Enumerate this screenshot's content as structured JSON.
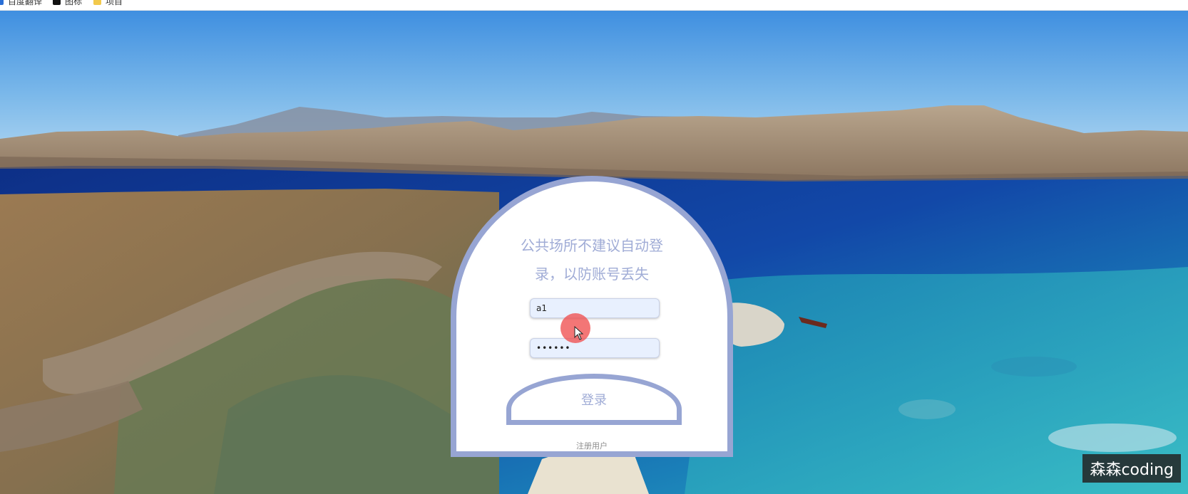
{
  "bookmarks": [
    {
      "label": "百度翻译",
      "icon": "translate-icon",
      "color": "#2a6fd6"
    },
    {
      "label": "图标",
      "icon": "iconfont-icon",
      "color": "#111111"
    },
    {
      "label": "项目",
      "icon": "folder-icon",
      "color": "#f2c94c"
    }
  ],
  "login": {
    "title_line1": "公共场所不建议自动登",
    "title_line2": "录，以防账号丢失",
    "username_value": "a1",
    "password_value": "••••••",
    "submit_label": "登录",
    "register_label": "注册用户"
  },
  "colors": {
    "accent": "#97a5d3",
    "title_text": "#a0acd6",
    "input_bg": "#e8f0fe",
    "click_indicator": "#f05050"
  },
  "watermark": "森森coding"
}
